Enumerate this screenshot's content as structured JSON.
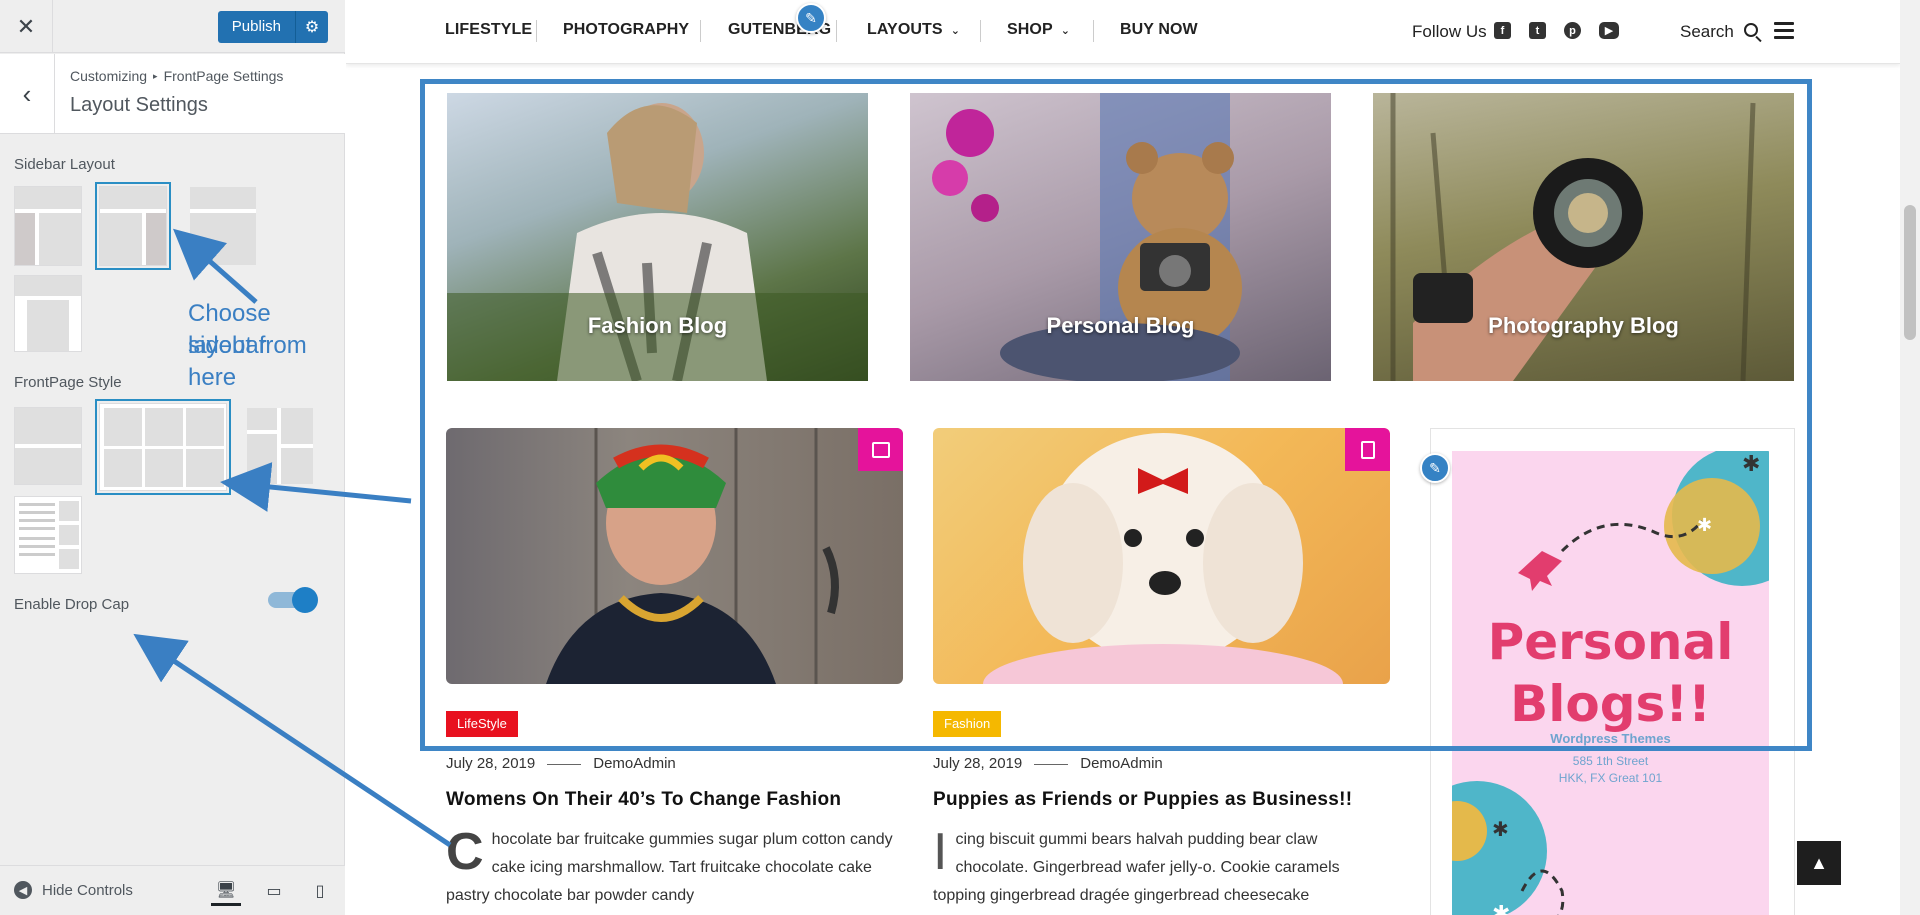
{
  "customizer": {
    "publish_label": "Publish",
    "breadcrumb": {
      "root": "Customizing",
      "parent": "FrontPage Settings"
    },
    "section_title": "Layout Settings",
    "sidebar_layout_label": "Sidebar Layout",
    "frontpage_style_label": "FrontPage Style",
    "drop_cap_label": "Enable Drop Cap",
    "drop_cap_enabled": true,
    "hide_controls_label": "Hide Controls"
  },
  "annotations": {
    "sidebar_hint_line1": "Choose sidebar",
    "sidebar_hint_line2": "layout from here",
    "arrow_color": "#3a7fc3"
  },
  "nav": {
    "items": [
      "LIFESTYLE",
      "PHOTOGRAPHY",
      "GUTENBERG",
      "LAYOUTS",
      "SHOP",
      "BUY NOW"
    ],
    "follow_label": "Follow Us",
    "social_icons": [
      "facebook-icon",
      "twitter-icon",
      "pinterest-icon",
      "youtube-icon"
    ],
    "search_label": "Search"
  },
  "categories": [
    {
      "title": "Fashion Blog"
    },
    {
      "title": "Personal Blog"
    },
    {
      "title": "Photography Blog"
    }
  ],
  "posts": [
    {
      "tag": "LifeStyle",
      "tag_color": "#e8111f",
      "date": "July 28, 2019",
      "author": "DemoAdmin",
      "title": "Womens On Their 40’s To Change Fashion",
      "dropcap": "C",
      "excerpt": "hocolate bar fruitcake gummies sugar plum cotton candy cake icing marshmallow. Tart fruitcake chocolate cake pastry chocolate bar powder candy",
      "format_icon": "image-icon"
    },
    {
      "tag": "Fashion",
      "tag_color": "#f5b800",
      "date": "July 28, 2019",
      "author": "DemoAdmin",
      "title": "Puppies as Friends or Puppies as Business!!",
      "dropcap": "I",
      "excerpt": "cing biscuit gummi bears halvah pudding bear claw chocolate. Gingerbread wafer jelly-o. Cookie caramels topping gingerbread dragée gingerbread cheesecake",
      "format_icon": "document-icon"
    }
  ],
  "ad": {
    "title_line1": "Personal",
    "title_line2": "Blogs!!",
    "subtitle": "Wordpress Themes",
    "address": "585 1th Street\nHKK, FX  Great 101"
  }
}
